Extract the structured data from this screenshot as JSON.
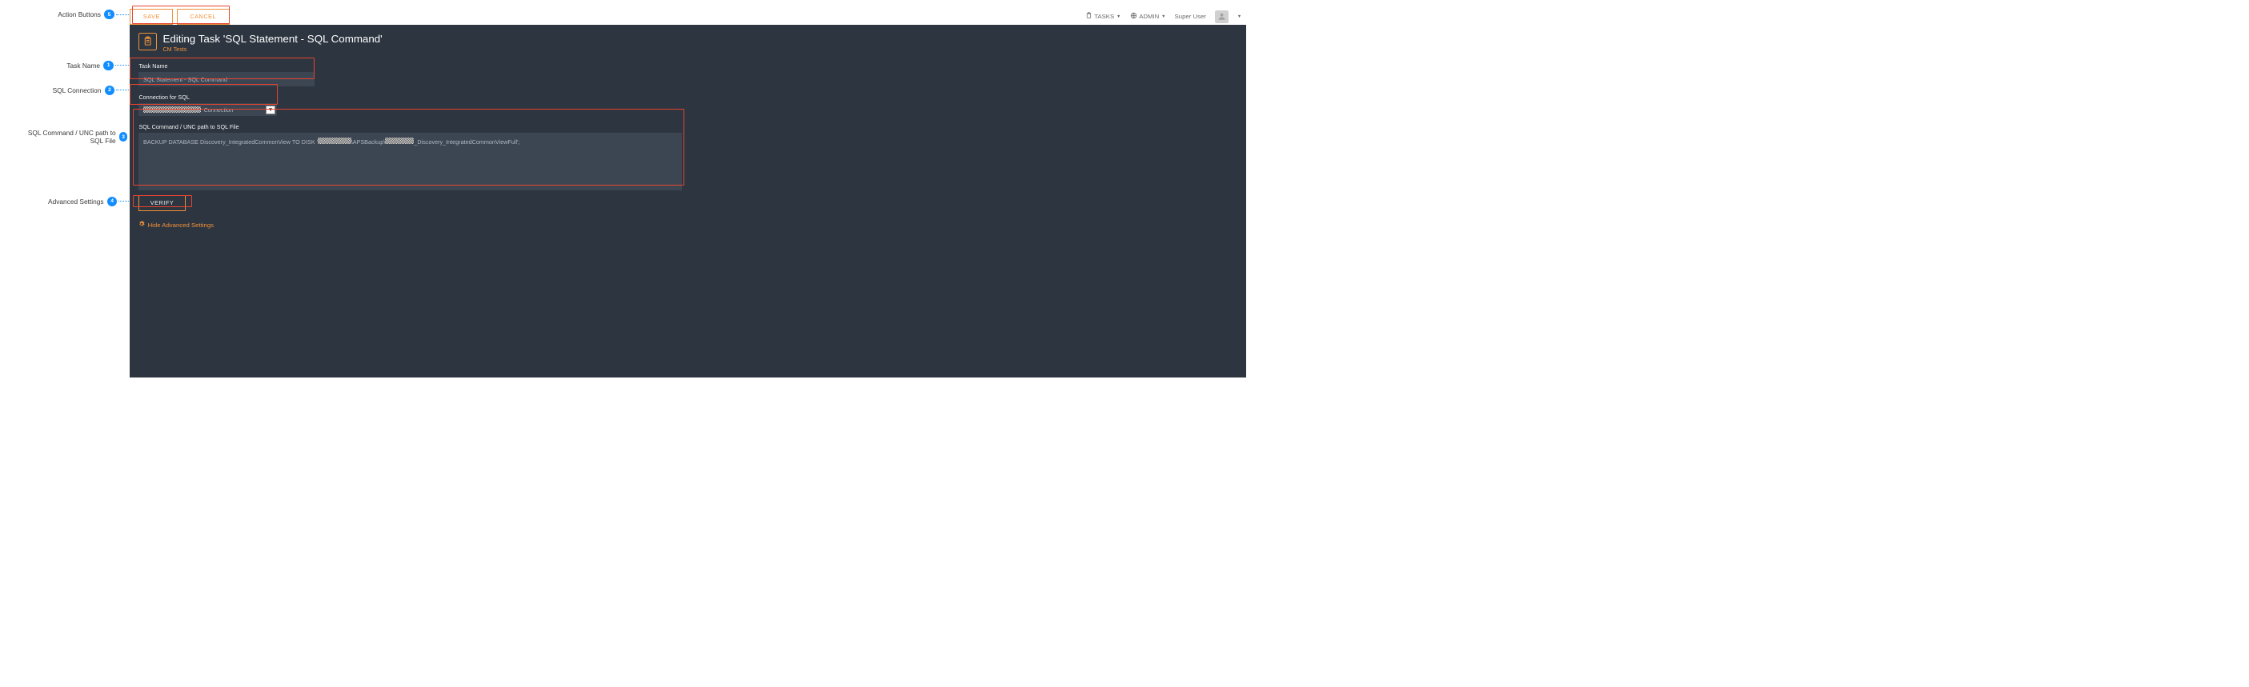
{
  "top_bar": {
    "save_label": "SAVE",
    "cancel_label": "CANCEL",
    "tasks_label": "TASKS",
    "admin_label": "ADMIN",
    "user_label": "Super User"
  },
  "panel": {
    "title": "Editing Task 'SQL Statement - SQL Command'",
    "breadcrumb": "CM Tests"
  },
  "fields": {
    "task_name_label": "Task Name",
    "task_name_value": "SQL Statement - SQL Command",
    "connection_label": "Connection for SQL",
    "connection_suffix": " Connection",
    "sql_label": "SQL Command / UNC path to SQL File",
    "sql_prefix": "BACKUP DATABASE Discovery_IntegratedCommonView TO DISK '",
    "sql_mid": "\\APSBackup\\",
    "sql_suffix": "_Discovery_IntegratedCommonViewFull';",
    "verify_label": "VERIFY",
    "adv_label": "Hide Advanced Settings"
  },
  "callouts": {
    "c1": {
      "text": "Action Buttons",
      "num": "5"
    },
    "c2": {
      "text": "Task Name",
      "num": "1"
    },
    "c3": {
      "text": "SQL Connection",
      "num": "2"
    },
    "c4": {
      "text": "SQL Command / UNC path to SQL File",
      "num": "3"
    },
    "c5": {
      "text": "Advanced Settings",
      "num": "4"
    }
  }
}
